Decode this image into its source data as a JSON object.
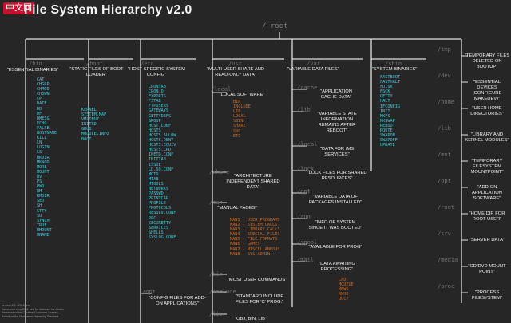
{
  "header": {
    "logo_text": "中文网",
    "title": "File System Hierarchy v2.0"
  },
  "root": "/ root",
  "columns": [
    {
      "dir": "/bin",
      "desc": "\"ESSENTIAL BINARIES\"",
      "items": [
        "CAT",
        "CHGRP",
        "CHMOD",
        "CHOWN",
        "CP",
        "DATE",
        "DD",
        "DF",
        "DMESG",
        "ECHO",
        "FALSE",
        "HOSTNAME",
        "KILL",
        "LN",
        "LOGIN",
        "LS",
        "MKDIR",
        "MKNOD",
        "MORE",
        "MOUNT",
        "MV",
        "PS",
        "PWD",
        "RM",
        "RMDIR",
        "SED",
        "SH",
        "STTY",
        "SU",
        "SYNCH",
        "TRUE",
        "UMOUNT",
        "UNAME"
      ]
    },
    {
      "dir": "/boot",
      "desc": "\"STATIC FILES OF BOOT LOADER\"",
      "items": [
        "KERNEL",
        "SYSTEM.MAP",
        "VMLINUZ",
        "INITRD",
        "GRUB",
        "MODULE.INFO",
        "BOOT"
      ]
    },
    {
      "dir": "/etc",
      "desc": "\"HOST SPECIFIC SYSTEM CONFIG\"",
      "items": [
        "CRONTAB",
        "CRON.D",
        "EXPORTS",
        "FSTAB",
        "FTPUSERS",
        "GATEWAYS",
        "GETTYDEFS",
        "GROUP",
        "HOST.CONF",
        "HOSTS",
        "HOSTS.ALLOW",
        "HOSTS.DENY",
        "HOSTS.EQUIV",
        "HOSTS.LPD",
        "INETD.CONF",
        "INITTAB",
        "ISSUE",
        "LD.SO.CONF",
        "MOTD",
        "MTAB",
        "MTOOLS",
        "NETWORKS",
        "PASSWD",
        "PRINTCAP",
        "PROFILE",
        "PROTOCOLS",
        "RESOLV.CONF",
        "RPC",
        "SECURETTY",
        "SERVICES",
        "SHELLS",
        "SYSLOG.CONF"
      ],
      "sub_dir": "/opt",
      "sub_desc": "\"CONFIG FILES FOR ADD-ON APPLICATIONS\""
    },
    {
      "dir": "/usr",
      "desc": "\"MULTI-USER SHARE AND READ-ONLY DATA\"",
      "groups": [
        {
          "dir": "/local",
          "desc": "\"LOCAL SOFTWARE\"",
          "items": [
            "BIN",
            "INCLUDE",
            "LIB",
            "LOCAL",
            "SBIN",
            "SHARE",
            "SRC",
            "ETC"
          ]
        },
        {
          "dir": "/share",
          "desc": "\"ARCHITECTURE INDEPENDENT SHARED DATA\"",
          "items": []
        },
        {
          "dir": "/man",
          "desc": "\"MANUAL PAGES\"",
          "items": [
            "MAN1 - USER PROGRAMS",
            "MAN2 - SYSTEM CALLS",
            "MAN3 - LIBRARY CALLS",
            "MAN4 - SPECIAL FILES",
            "MAN5 - FILE FORMATS",
            "MAN6 - GAMES",
            "MAN7 - MISCELLANEOUS",
            "MAN8 - SYS ADMIN"
          ]
        },
        {
          "dir": "/bin",
          "desc": "\"MOST USER COMMANDS\"",
          "items": []
        },
        {
          "dir": "/include",
          "desc": "\"STANDARD INCLUDE FILES FOR 'C' PROG.\"",
          "items": []
        },
        {
          "dir": "/lib",
          "desc": "\"OBJ, BIN, LIB\"",
          "items": []
        }
      ]
    },
    {
      "dir": "/var",
      "desc": "\"VARIABLE DATA FILES\"",
      "groups": [
        {
          "dir": "/cache",
          "desc": "\"APPLICATION CACHE DATA\""
        },
        {
          "dir": "/lib",
          "desc": "\"VARIABLE STATE INFORMATION REMAINS AFTER REBOOT\""
        },
        {
          "dir": "/local",
          "desc": "\"DATA FOR /MS SERVICES\""
        },
        {
          "dir": "/lock",
          "desc": "\"LOCK FILES FOR SHARED RESOURCES\""
        },
        {
          "dir": "/opt",
          "desc": "\"VARIABLE DATA OF PACKAGES INSTALLED\""
        },
        {
          "dir": "/run",
          "desc": "\"INFO OF SYSTEM SINCE IT WAS BOOTED\""
        },
        {
          "dir": "/spool",
          "desc": "\"AVAILABLE FOR PROG\""
        },
        {
          "dir": "/mail",
          "desc": "\"DATA AWAITING PROCESSING\"",
          "items": [
            "LPD",
            "MQUEUE",
            "NEWS",
            "RWHO",
            "UUCP"
          ]
        }
      ]
    },
    {
      "dir": "/sbin",
      "desc": "\"SYSTEM BINARIES\"",
      "items": [
        "FASTBOOT",
        "FASTHALT",
        "FDISK",
        "FSCK",
        "GETTY",
        "HALT",
        "IFCONFIG",
        "INIT",
        "MKFS",
        "MKSWAP",
        "REBOOT",
        "ROUTE",
        "SWAPON",
        "SWAPOFF",
        "UPDATE"
      ]
    }
  ],
  "right": [
    {
      "dir": "/tmp",
      "desc": "\"TEMPORARY FILES DELETED ON BOOTUP\""
    },
    {
      "dir": "/dev",
      "desc": "\"ESSENTIAL DEVICES (CONFIGURE MAKEDEV)\""
    },
    {
      "dir": "/home",
      "desc": "\"USER HOME DIRECTORIES\""
    },
    {
      "dir": "/lib",
      "desc": "\"LIBRARY AND KERNEL MODULES\""
    },
    {
      "dir": "/mnt",
      "desc": "\"TEMPORARY FILESYSTEM MOUNTPOINT\""
    },
    {
      "dir": "/opt",
      "desc": "\"ADD-ON APPLICATION SOFTWARE\""
    },
    {
      "dir": "/root",
      "desc": "\"HOME DIR FOR ROOT USER\""
    },
    {
      "dir": "/srv",
      "desc": "\"SERVER DATA\""
    },
    {
      "dir": "/media",
      "desc": "\"CD/DVD MOUNT POINT\""
    },
    {
      "dir": "/proc",
      "desc": "\"PROCESS FILESYSTEM\""
    }
  ],
  "footer": [
    "version 2.0 - 2015 rev",
    "Somewhat simplified, see full standard for details",
    "Released under Creative Commons License",
    "Based on the Filesystem Hierarchy Standard"
  ],
  "colors": {
    "background": "#262626",
    "line": "#e0e0e0",
    "dir": "#727272",
    "binary": "#3ec7dd",
    "local": "#c56a2a"
  }
}
